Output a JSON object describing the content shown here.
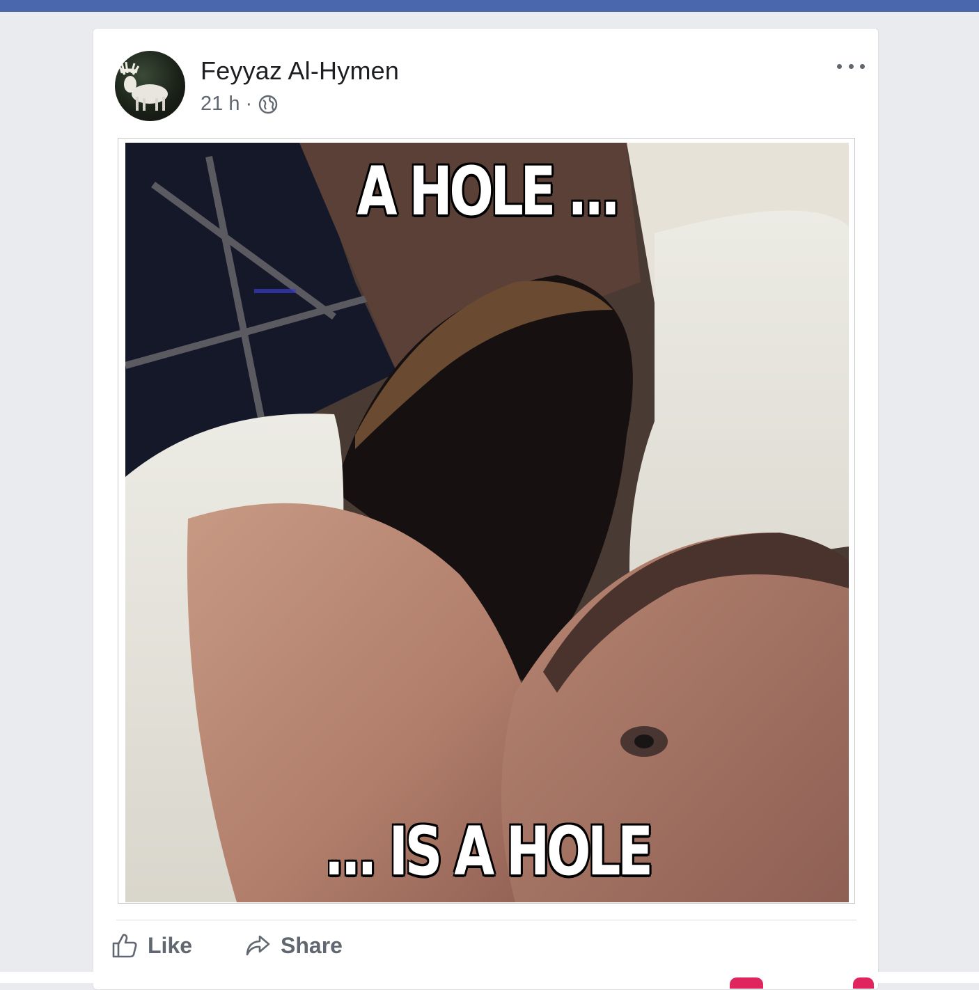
{
  "post": {
    "author": "Feyyaz Al-Hymen",
    "time": "21 h",
    "separator": "·",
    "privacy_icon": "globe-icon",
    "more_icon": "more-options-icon",
    "meme_top_text": "A HOLE ...",
    "meme_bottom_text": "... IS A HOLE"
  },
  "actions": {
    "like_label": "Like",
    "like_icon": "thumbs-up-icon",
    "share_label": "Share",
    "share_icon": "share-arrow-icon"
  },
  "colors": {
    "header_blue": "#4a67ad",
    "page_bg": "#e9ebee",
    "secondary_text": "#606770",
    "notification_red": "#e0245e"
  }
}
